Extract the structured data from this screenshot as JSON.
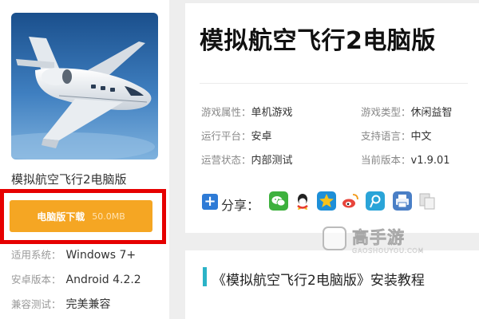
{
  "game": {
    "name": "模拟航空飞行2电脑版",
    "title": "模拟航空飞行2电脑版"
  },
  "download": {
    "label": "电脑版下载",
    "size": "50.0MB"
  },
  "system": [
    {
      "key": "适用系统：",
      "value": "Windows 7+"
    },
    {
      "key": "安卓版本：",
      "value": "Android 4.2.2"
    },
    {
      "key": "兼容测试：",
      "value": "完美兼容"
    }
  ],
  "attributes": [
    {
      "key": "游戏属性：",
      "value": "单机游戏"
    },
    {
      "key": "游戏类型：",
      "value": "休闲益智"
    },
    {
      "key": "运行平台：",
      "value": "安卓"
    },
    {
      "key": "支持语言：",
      "value": "中文"
    },
    {
      "key": "运营状态：",
      "value": "内部测试"
    },
    {
      "key": "当前版本：",
      "value": "v1.9.01"
    }
  ],
  "share": {
    "label": "分享：",
    "icons": [
      "wechat-icon",
      "qq-icon",
      "qzone-icon",
      "weibo-icon",
      "tencent-weibo-icon",
      "print-icon",
      "copy-icon"
    ],
    "colors": [
      "#3db13d",
      "#1d9bd8",
      "#f0b400",
      "#e8453c",
      "#2aa4d8",
      "#4a7fc6",
      "#bbbbbb"
    ]
  },
  "guide": {
    "title": "《模拟航空飞行2电脑版》安装教程"
  },
  "watermark": {
    "main": "高手游",
    "sub": "GAOSHOUYOU.COM"
  },
  "colors": {
    "accent_orange": "#f5a623",
    "highlight_red": "#e60000",
    "share_blue": "#2e7bd6",
    "guide_bar": "#2bb3c7"
  }
}
